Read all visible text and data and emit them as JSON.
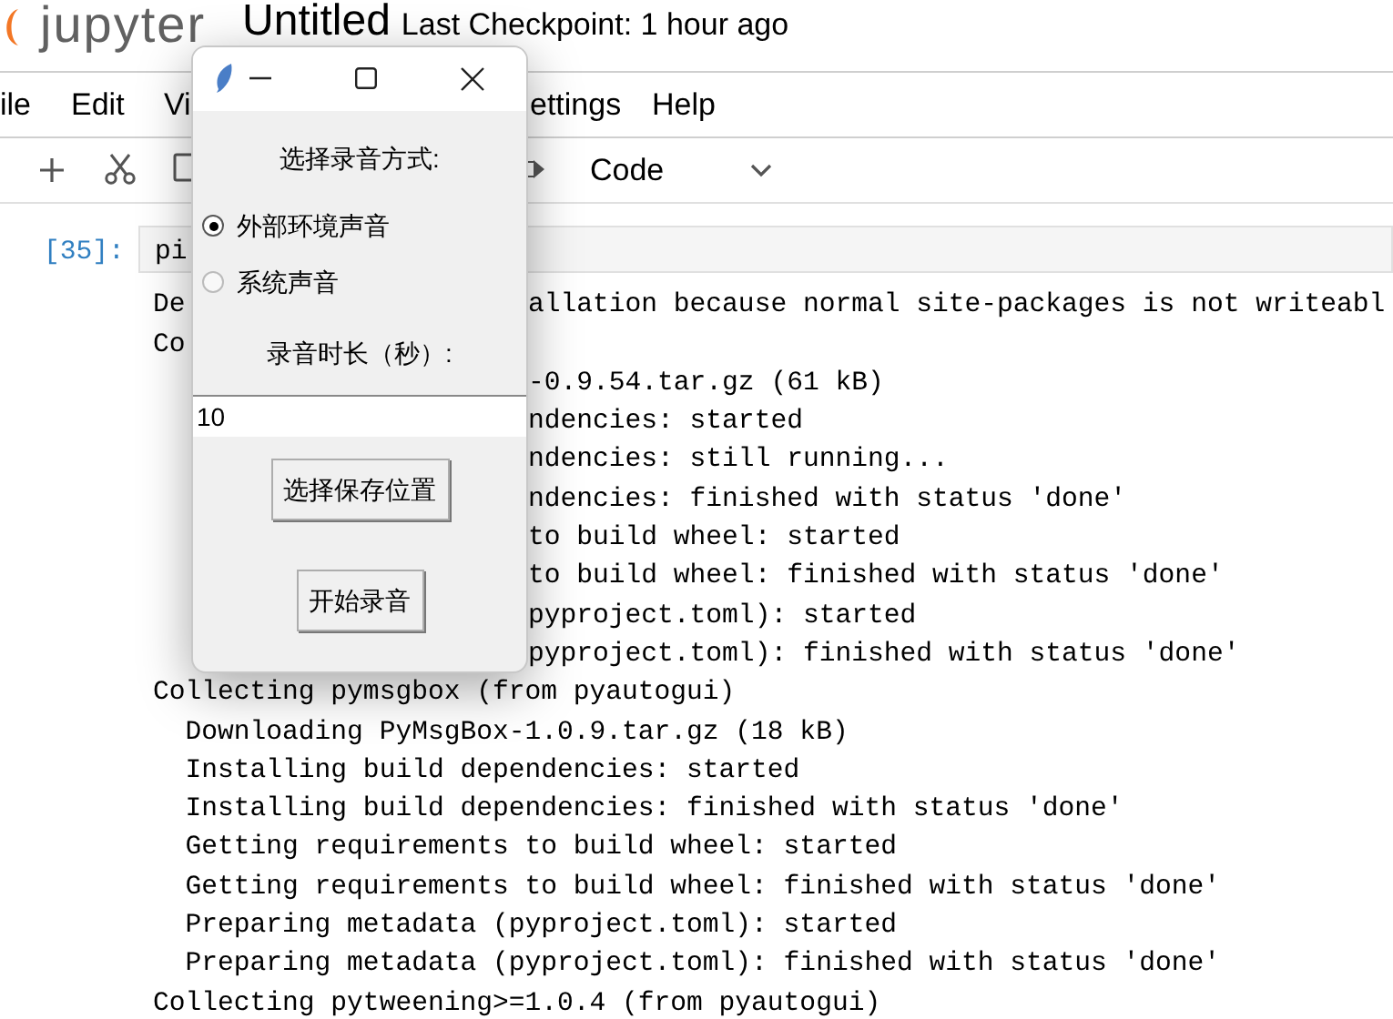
{
  "header": {
    "logo_text": "jupyter",
    "notebook_title": "Untitled",
    "checkpoint": "Last Checkpoint: 1 hour ago"
  },
  "menu": [
    "ile",
    "Edit",
    "Vi",
    "ettings",
    "Help"
  ],
  "toolbar": {
    "cell_type": "Code"
  },
  "cell": {
    "prompt": "[35]:",
    "input": "pi"
  },
  "output": [
    {
      "left": "De",
      "right": "allation because normal site-packages is not writeabl"
    },
    {
      "left": "Co"
    },
    {
      "right": "-0.9.54.tar.gz (61 kB)"
    },
    {
      "right": "ndencies: started"
    },
    {
      "right": "ndencies: still running..."
    },
    {
      "right": "ndencies: finished with status 'done'"
    },
    {
      "right": "to build wheel: started"
    },
    {
      "right": "to build wheel: finished with status 'done'"
    },
    {
      "right": "pyproject.toml): started"
    },
    {
      "right": "pyproject.toml): finished with status 'done'"
    },
    {
      "left": "Collecting pymsgbox (from pyautogui)"
    },
    {
      "left": "  Downloading PyMsgBox-1.0.9.tar.gz (18 kB)"
    },
    {
      "left": "  Installing build dependencies: started"
    },
    {
      "left": "  Installing build dependencies: finished with status 'done'"
    },
    {
      "left": "  Getting requirements to build wheel: started"
    },
    {
      "left": "  Getting requirements to build wheel: finished with status 'done'"
    },
    {
      "left": "  Preparing metadata (pyproject.toml): started"
    },
    {
      "left": "  Preparing metadata (pyproject.toml): finished with status 'done'"
    },
    {
      "left": "Collecting pytweening>=1.0.4 (from pyautogui)"
    }
  ],
  "dialog": {
    "prompt": "选择录音方式:",
    "options": [
      {
        "label": "外部环境声音",
        "selected": true
      },
      {
        "label": "系统声音",
        "selected": false
      }
    ],
    "duration_label": "录音时长（秒）:",
    "duration_value": "10",
    "buttons": [
      "选择保存位置",
      "开始录音"
    ]
  }
}
